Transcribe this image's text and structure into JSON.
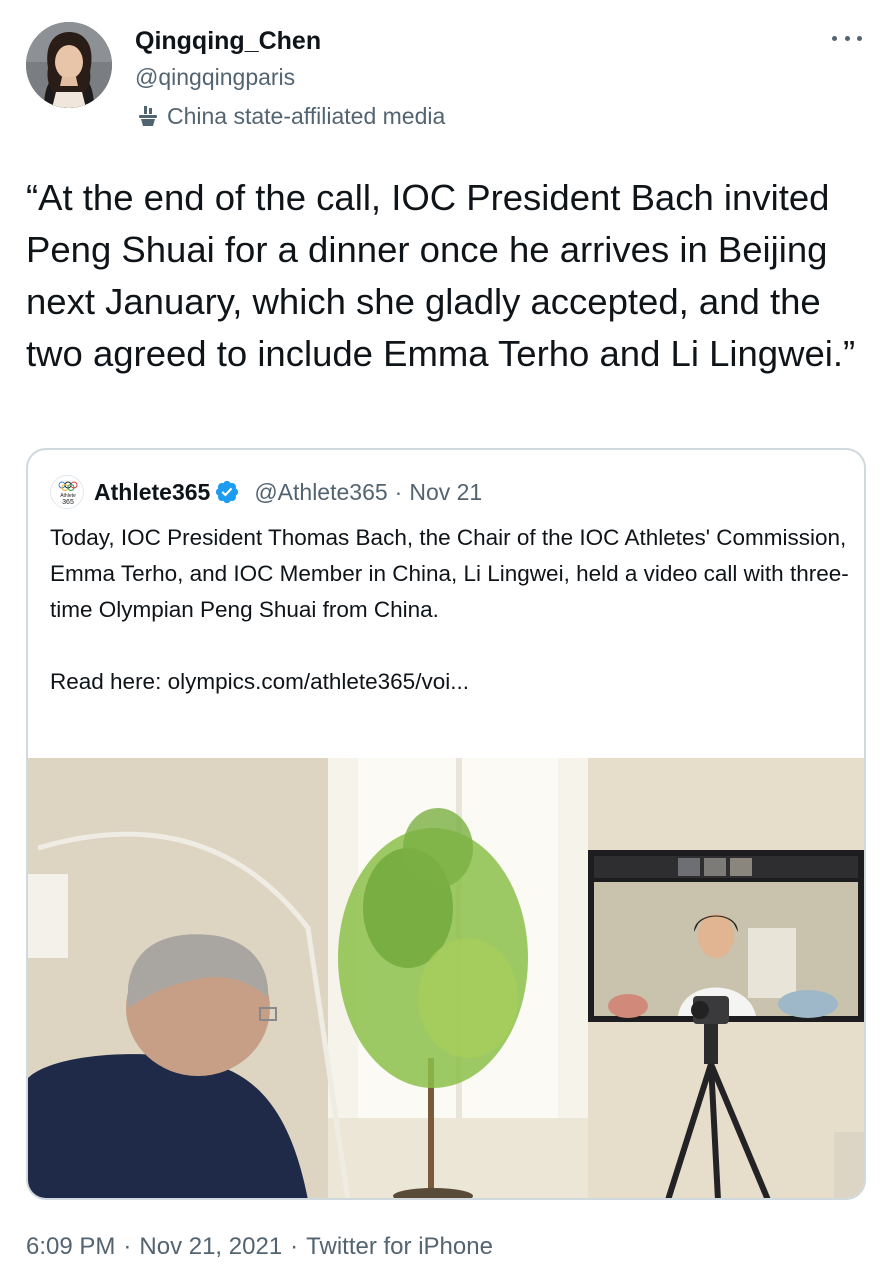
{
  "author": {
    "display_name": "Qingqing_Chen",
    "handle": "@qingqingparis",
    "label": "China state-affiliated media",
    "label_icon": "podium-icon",
    "avatar_icon": "profile-photo"
  },
  "tweet": {
    "text": "“At the end of the call, IOC President Bach invited Peng Shuai for a dinner once he arrives in Beijing next January, which she gladly accepted, and the two agreed to include Emma Terho and Li Lingwei.”"
  },
  "quoted_tweet": {
    "display_name": "Athlete365",
    "handle": "@Athlete365",
    "separator": "·",
    "date": "Nov 21",
    "avatar_text_top": "Athlete",
    "avatar_text_bottom": "365",
    "body_paragraph_1": "Today, IOC President Thomas Bach, the Chair of the IOC Athletes' Commission, Emma Terho, and IOC Member in China, Li Lingwei, held a video call with three-time Olympian Peng Shuai from China.",
    "body_paragraph_2": "Read here: olympics.com/athlete365/voi...",
    "verified_icon": "verified-badge-icon",
    "media_description": "photo"
  },
  "footer": {
    "time": "6:09 PM",
    "sep1": "·",
    "date": "Nov 21, 2021",
    "sep2": "·",
    "source": "Twitter for iPhone"
  },
  "colors": {
    "text_primary": "#0f1419",
    "text_secondary": "#536471",
    "border": "#cfd9de",
    "verified_blue": "#1d9bf0"
  }
}
